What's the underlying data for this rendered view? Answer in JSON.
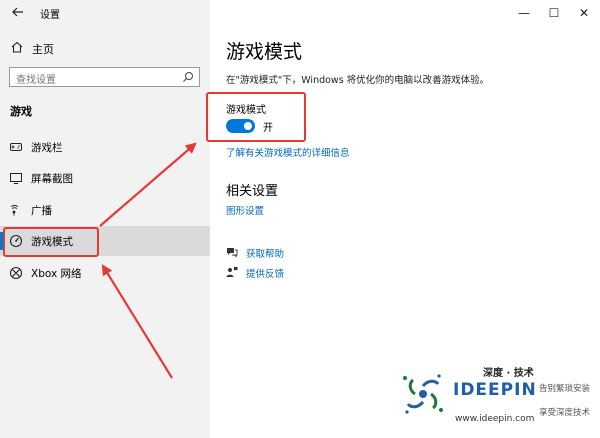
{
  "window": {
    "title": "设置",
    "controls": {
      "minimize": "—",
      "maximize": "☐",
      "close": "✕"
    }
  },
  "sidebar": {
    "home_label": "主页",
    "search_placeholder": "查找设置",
    "section_title": "游戏",
    "items": [
      {
        "label": "游戏栏",
        "icon": "game-bar-icon"
      },
      {
        "label": "屏幕截图",
        "icon": "capture-icon"
      },
      {
        "label": "广播",
        "icon": "broadcast-icon"
      },
      {
        "label": "游戏模式",
        "icon": "game-mode-icon",
        "selected": true
      },
      {
        "label": "Xbox 网络",
        "icon": "xbox-icon"
      }
    ]
  },
  "main": {
    "title": "游戏模式",
    "description": "在\"游戏模式\"下，Windows 将优化你的电脑以改善游戏体验。",
    "toggle_caption": "游戏模式",
    "toggle_state": "开",
    "toggle_on": true,
    "learn_more": "了解有关游戏模式的详细信息",
    "related_title": "相关设置",
    "graphics_link": "图形设置",
    "help_link": "获取帮助",
    "feedback_link": "提供反馈"
  },
  "watermark": {
    "top": "深度 · 技术",
    "brand": "IDEEPIN",
    "site": "www.ideepin.com",
    "side1": "告别繁琐安装",
    "side2": "享受深度技术"
  },
  "colors": {
    "accent": "#0078d7",
    "link": "#0067c0",
    "annotation": "#e53935",
    "sidebar_bg": "#f2f2f2"
  }
}
